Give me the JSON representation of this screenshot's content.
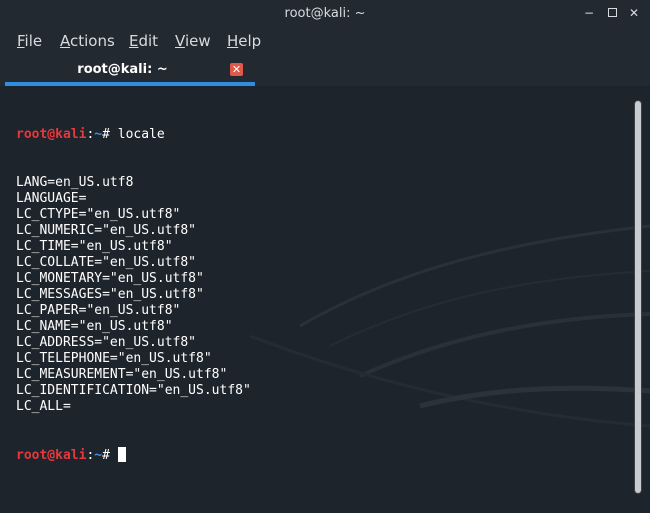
{
  "window": {
    "title": "root@kali: ~"
  },
  "window_controls": {
    "minimize": "−",
    "close": "✕"
  },
  "menu": {
    "items": [
      {
        "accel": "F",
        "rest": "ile"
      },
      {
        "accel": "A",
        "rest": "ctions"
      },
      {
        "accel": "E",
        "rest": "dit"
      },
      {
        "accel": "V",
        "rest": "iew"
      },
      {
        "accel": "H",
        "rest": "elp"
      }
    ]
  },
  "tab": {
    "label": "root@kali: ~",
    "close_glyph": "✕"
  },
  "prompt": {
    "user": "root@kali",
    "sep": ":",
    "path": "~",
    "symbol": "# "
  },
  "terminal": {
    "command": "locale",
    "output": [
      "LANG=en_US.utf8",
      "LANGUAGE=",
      "LC_CTYPE=\"en_US.utf8\"",
      "LC_NUMERIC=\"en_US.utf8\"",
      "LC_TIME=\"en_US.utf8\"",
      "LC_COLLATE=\"en_US.utf8\"",
      "LC_MONETARY=\"en_US.utf8\"",
      "LC_MESSAGES=\"en_US.utf8\"",
      "LC_PAPER=\"en_US.utf8\"",
      "LC_NAME=\"en_US.utf8\"",
      "LC_ADDRESS=\"en_US.utf8\"",
      "LC_TELEPHONE=\"en_US.utf8\"",
      "LC_MEASUREMENT=\"en_US.utf8\"",
      "LC_IDENTIFICATION=\"en_US.utf8\"",
      "LC_ALL="
    ]
  },
  "colors": {
    "background": "#1e242b",
    "prompt_user": "#e6383d",
    "prompt_path": "#3d8ee0",
    "tab_accent": "#2f8ee0",
    "tab_close": "#e0584a"
  }
}
